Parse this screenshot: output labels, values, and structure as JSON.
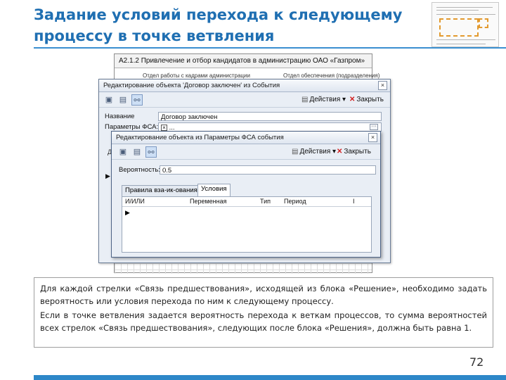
{
  "slide": {
    "title": "Задание условий перехода к следующему процессу в точке ветвления",
    "page_number": "72",
    "body_paragraphs": [
      "Для каждой стрелки «Связь предшествования», исходящей из блока «Решение», необходимо задать вероятность или условия перехода по ним к следующему процессу.",
      "Если в точке ветвления задается вероятность перехода к веткам процессов, то сумма вероятностей всех стрелок «Связь предшествования», следующих после блока «Решения», должна быть равна 1."
    ]
  },
  "background_window": {
    "title": "A2.1.2 Привлечение и отбор кандидатов в администрацию ОАО «Газпром»",
    "col1": "Отдел работы с кадрами администрации",
    "col2": "Отдел обеспечения (подразделения)"
  },
  "outer_dialog": {
    "title": "Редактирование объекта 'Договор заключен' из События",
    "close_glyph": "×",
    "actions_label": "Действия",
    "close_label": "Закрыть",
    "name_label": "Название",
    "name_value": "Договор заключен",
    "params_label": "Параметры ФСА:",
    "params_checkbox": "×",
    "params_value": "...",
    "ellipsis": "···",
    "side_arrow": "▶",
    "side_mark": "Д"
  },
  "inner_dialog": {
    "title": "Редактирование объекта из Параметры ФСА события",
    "close_glyph": "×",
    "actions_label": "Действия",
    "close_label": "Закрыть",
    "probability_label": "Вероятность:",
    "probability_value": "0.5",
    "tabs": [
      "Правила вза-ик-ования",
      "Условия"
    ],
    "table_headers": [
      "И/ИЛИ",
      "Переменная",
      "Тип",
      "Период",
      "I"
    ],
    "row_marker": "▶"
  },
  "icons": {
    "toolbar": [
      "save-icon",
      "properties-icon",
      "link-icon"
    ],
    "actions": "actions-icon",
    "close": "close-x-icon"
  },
  "colors": {
    "title": "#1f6fb2",
    "accent_bar": "#2d87c8",
    "dialog_bg": "#e9eef5",
    "thumb_highlight": "#e39a2f"
  }
}
